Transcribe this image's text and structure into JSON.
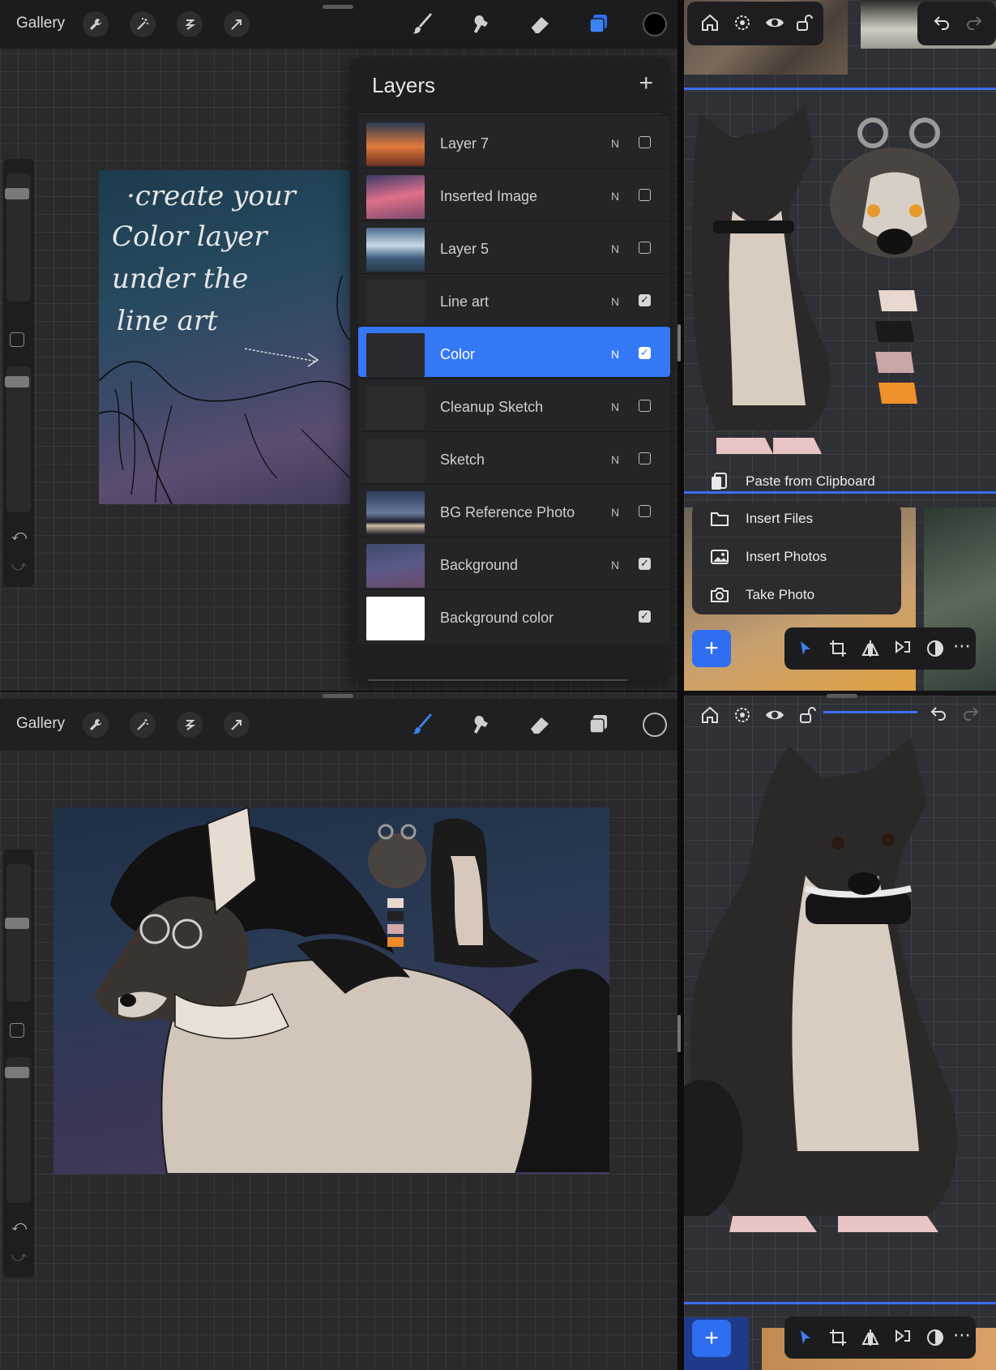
{
  "top_app": {
    "gallery_label": "Gallery",
    "layers": {
      "title": "Layers",
      "add_icon": "plus-icon",
      "items": [
        {
          "name": "Layer 7",
          "blend": "N",
          "visible": false,
          "thumb": "sunset-clouds"
        },
        {
          "name": "Inserted Image",
          "blend": "N",
          "visible": false,
          "thumb": "pink-sky"
        },
        {
          "name": "Layer 5",
          "blend": "N",
          "visible": false,
          "thumb": "cloudy-sea"
        },
        {
          "name": "Line art",
          "blend": "N",
          "visible": true,
          "thumb": "line-art"
        },
        {
          "name": "Color",
          "blend": "N",
          "visible": true,
          "thumb": "dark",
          "selected": true
        },
        {
          "name": "Cleanup Sketch",
          "blend": "N",
          "visible": false,
          "thumb": "sketch"
        },
        {
          "name": "Sketch",
          "blend": "N",
          "visible": false,
          "thumb": "sketch"
        },
        {
          "name": "BG Reference Photo",
          "blend": "N",
          "visible": false,
          "thumb": "mountains"
        },
        {
          "name": "Background",
          "blend": "N",
          "visible": true,
          "thumb": "night-sky"
        },
        {
          "name": "Background color",
          "blend": "",
          "visible": true,
          "thumb": "white"
        }
      ]
    },
    "canvas_note": [
      "·create your",
      "Color layer",
      "under the",
      "line art"
    ]
  },
  "bottom_app": {
    "gallery_label": "Gallery"
  },
  "right_app": {
    "insert_menu": {
      "items": [
        {
          "label": "Paste from Clipboard",
          "icon": "clipboard-icon"
        },
        {
          "label": "Insert Files",
          "icon": "folder-icon"
        },
        {
          "label": "Insert Photos",
          "icon": "photo-icon"
        },
        {
          "label": "Take Photo",
          "icon": "camera-icon"
        }
      ]
    },
    "add_button": "+"
  },
  "colors": {
    "accent": "#3478f6",
    "toolbar_bg": "#1c1c1e",
    "panel_bg": "#1f1f21",
    "canvas_grid": "#2a2a2c"
  }
}
